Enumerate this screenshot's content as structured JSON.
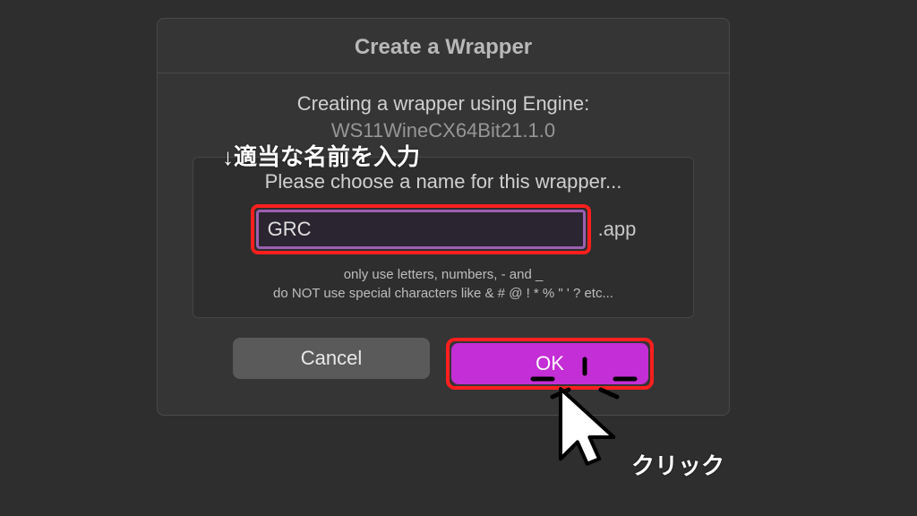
{
  "dialog": {
    "title": "Create a Wrapper",
    "engine_label": "Creating a wrapper using Engine:",
    "engine_name": "WS11WineCX64Bit21.1.0",
    "prompt": "Please choose a name for this wrapper...",
    "input_value": "GRC",
    "suffix": ".app",
    "hint1": "only use letters, numbers, - and _",
    "hint2": "do NOT use special characters like & # @ ! * % \" ' ? etc...",
    "cancel_label": "Cancel",
    "ok_label": "OK"
  },
  "annotations": {
    "input_hint": "↓適当な名前を入力",
    "click_hint": "クリック"
  }
}
